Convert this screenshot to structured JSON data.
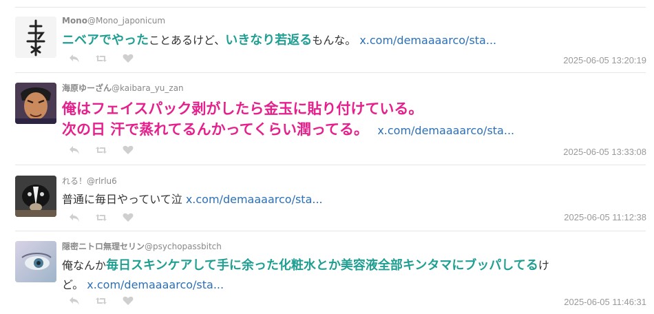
{
  "tweets": [
    {
      "display_name": "Mono",
      "handle": "@Mono_japonicum",
      "text": {
        "p1": "ニベアでやった",
        "p2": "ことあるけど、",
        "p3": "いきなり若返る",
        "p4": "もんな。"
      },
      "link": "x.com/demaaaarco/sta...",
      "timestamp": "2025-06-05 13:20:19"
    },
    {
      "display_name": "海原ゆーざん",
      "handle": "@kaibara_yu_zan",
      "text": {
        "line1": "俺はフェイスパック剥がしたら金玉に貼り付けている。",
        "line2": "次の日 汗で蒸れてるんかってくらい潤ってる。"
      },
      "link": "x.com/demaaaarco/sta...",
      "timestamp": "2025-06-05 13:33:08"
    },
    {
      "display_name": "れる！",
      "handle": "@rlrlu6",
      "text": {
        "p1": "普通に毎日やっていて泣"
      },
      "link": "x.com/demaaaarco/sta...",
      "timestamp": "2025-06-05 11:12:38"
    },
    {
      "display_name": "隠密ニトロ無理セリン",
      "handle": "@psychopassbitch",
      "text": {
        "p1": "俺なんか",
        "p2": "毎日スキンケアして手に余った化粧水とか美容液全部キンタマにブッパしてる",
        "p3": "け",
        "p4": "ど。"
      },
      "link": "x.com/demaaaarco/sta...",
      "timestamp": "2025-06-05 11:46:31"
    }
  ],
  "colors": {
    "teal": "#1f9e92",
    "pink": "#e51f8c",
    "link": "#2a6fb8",
    "muted": "#999999"
  },
  "icons": [
    "reply-icon",
    "retweet-icon",
    "like-icon"
  ]
}
